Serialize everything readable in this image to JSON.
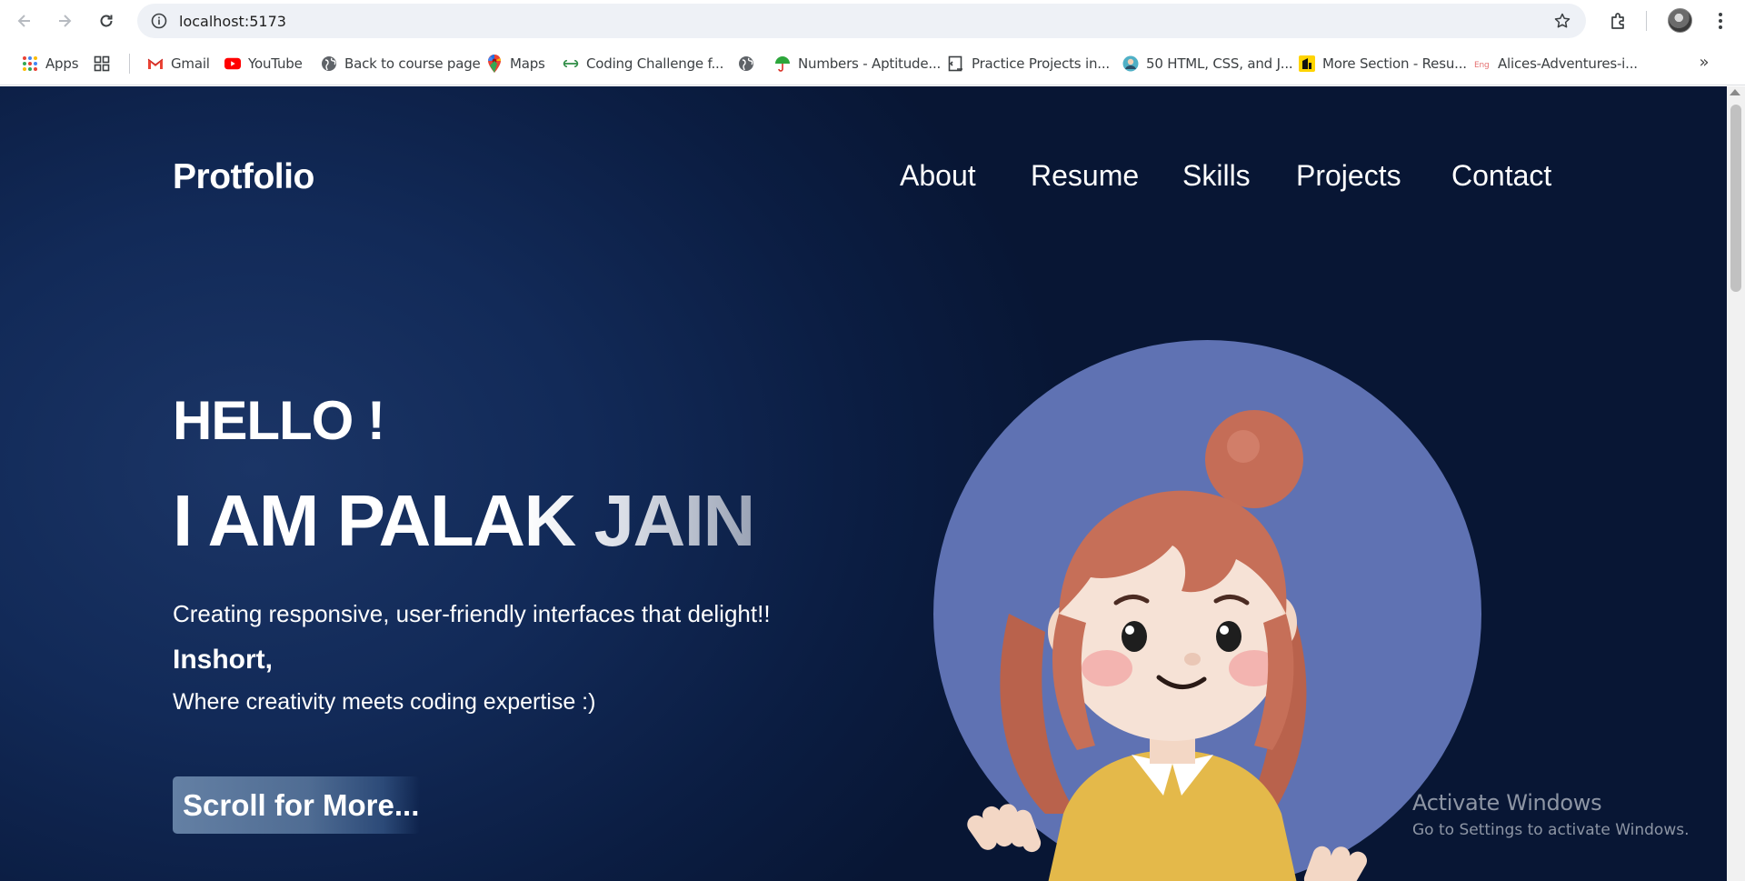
{
  "browser": {
    "url": "localhost:5173",
    "bookmarks": [
      {
        "label": "Apps",
        "icon": "apps-grid-icon"
      },
      {
        "label": "",
        "icon": "tab-groups-icon"
      },
      {
        "label": "Gmail",
        "icon": "gmail-icon"
      },
      {
        "label": "YouTube",
        "icon": "youtube-icon"
      },
      {
        "label": "Back to course page",
        "icon": "globe-icon"
      },
      {
        "label": "Maps",
        "icon": "maps-pin-icon"
      },
      {
        "label": "Coding Challenge f...",
        "icon": "geeks-icon"
      },
      {
        "label": "",
        "icon": "globe-icon"
      },
      {
        "label": "Numbers - Aptitude...",
        "icon": "umbrella-icon"
      },
      {
        "label": "Practice Projects in...",
        "icon": "code-icon"
      },
      {
        "label": "50 HTML, CSS, and J...",
        "icon": "person-icon"
      },
      {
        "label": "More Section - Resu...",
        "icon": "resume-icon"
      },
      {
        "label": "Alices-Adventures-i...",
        "icon": "book-icon"
      }
    ],
    "more_bookmarks": "»"
  },
  "site": {
    "brand": "Protfolio",
    "nav": [
      "About",
      "Resume",
      "Skills",
      "Projects",
      "Contact"
    ],
    "hero": {
      "hello": "HELLO !",
      "name": "I AM PALAK JAIN",
      "tagline": "Creating responsive, user-friendly interfaces that delight!!",
      "inshort": "Inshort,",
      "where": "Where creativity meets coding expertise :)",
      "cta": "Scroll for More..."
    }
  },
  "overlay": {
    "activate_title": "Activate Windows",
    "activate_sub": "Go to Settings to activate Windows."
  },
  "colors": {
    "page_bg": "#0b1d42",
    "avatar_circle": "#5f72b3",
    "hair": "#c66f58",
    "shirt": "#e4b94a"
  }
}
